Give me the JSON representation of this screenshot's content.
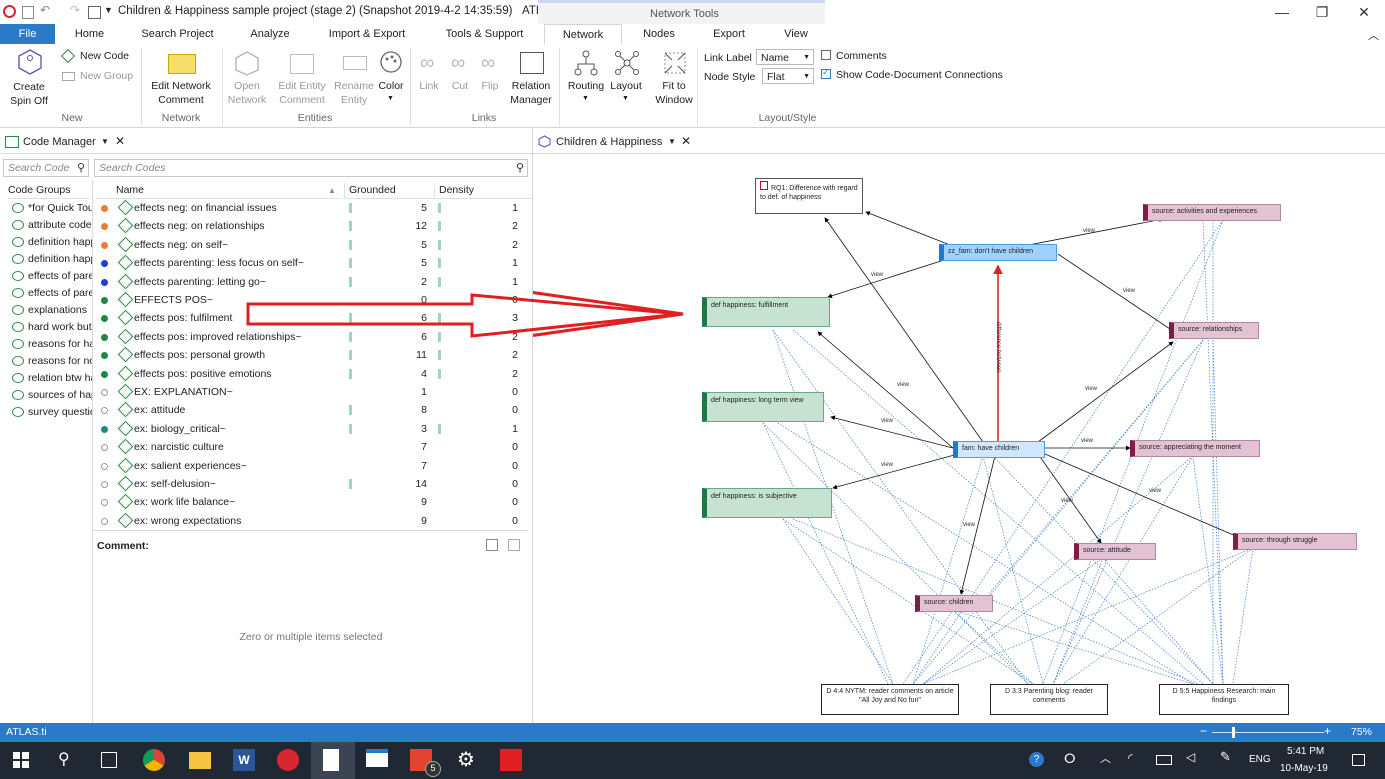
{
  "window": {
    "title": "Children & Happiness sample project (stage 2) (Snapshot 2019-4-2 14:35:59)",
    "app_name": "ATLAS.ti",
    "context_tab_group": "Network Tools",
    "quick_access_checkbox": "▼"
  },
  "ribbon_tabs": [
    "File",
    "Home",
    "Search Project",
    "Analyze",
    "Import & Export",
    "Tools & Support",
    "Network",
    "Nodes",
    "Export",
    "View"
  ],
  "ribbon": {
    "create_spin_off": "Create\nSpin Off",
    "new_code": "New Code",
    "new_group": "New Group",
    "grp_new": "New",
    "edit_network_comment": "Edit Network\nComment",
    "grp_network": "Network",
    "open_network": "Open\nNetwork",
    "edit_entity_comment": "Edit Entity\nComment",
    "rename_entity": "Rename\nEntity",
    "color": "Color",
    "grp_entities": "Entities",
    "link": "Link",
    "cut": "Cut",
    "flip": "Flip",
    "relation_manager": "Relation\nManager",
    "grp_links": "Links",
    "routing": "Routing",
    "layout": "Layout",
    "fit_to_window": "Fit to\nWindow",
    "link_label_lbl": "Link Label",
    "link_label_val": "Name",
    "node_style_lbl": "Node Style",
    "node_style_val": "Flat",
    "comments": "Comments",
    "show_code_doc": "Show Code-Document Connections",
    "grp_layout_style": "Layout/Style"
  },
  "code_manager": {
    "title": "Code Manager",
    "search_code_ph": "Search Code",
    "search_codes_ph": "Search Codes",
    "code_groups_header": "Code Groups",
    "col_name": "Name",
    "col_grounded": "Grounded",
    "col_density": "Density",
    "groups": [
      "*for Quick Tour",
      "attribute codes",
      "definition happiness",
      "definition happiness",
      "effects of parenting",
      "effects of parenting",
      "explanations",
      "hard work but",
      "reasons for having",
      "reasons for not",
      "relation btw happiness",
      "sources of happiness",
      "survey questions"
    ],
    "codes": [
      {
        "name": "effects neg: on financial issues",
        "g": "5",
        "d": "1",
        "dot": "#f07a30",
        "gbar": 1,
        "dbar": 1
      },
      {
        "name": "effects neg: on relationships",
        "g": "12",
        "d": "2",
        "dot": "#f07a30",
        "gbar": 1,
        "dbar": 1
      },
      {
        "name": "effects neg: on self~",
        "g": "5",
        "d": "2",
        "dot": "#f07a30",
        "gbar": 1,
        "dbar": 1
      },
      {
        "name": "effects parenting: less focus on self~",
        "g": "5",
        "d": "1",
        "dot": "#1a3fd6",
        "gbar": 1,
        "dbar": 1
      },
      {
        "name": "effects parenting: letting go~",
        "g": "2",
        "d": "1",
        "dot": "#1a3fd6",
        "gbar": 1,
        "dbar": 1
      },
      {
        "name": "EFFECTS POS~",
        "g": "0",
        "d": "0",
        "dot": "#1c8a3a",
        "gbar": 0,
        "dbar": 0
      },
      {
        "name": "effects pos: fulfilment",
        "g": "6",
        "d": "3",
        "dot": "#1c8a3a",
        "gbar": 1,
        "dbar": 1
      },
      {
        "name": "effects pos: improved relationships~",
        "g": "6",
        "d": "2",
        "dot": "#1c8a3a",
        "gbar": 1,
        "dbar": 1
      },
      {
        "name": "effects pos: personal growth",
        "g": "11",
        "d": "2",
        "dot": "#1c8a3a",
        "gbar": 1,
        "dbar": 1
      },
      {
        "name": "effects pos: positive emotions",
        "g": "4",
        "d": "2",
        "dot": "#1c8a3a",
        "gbar": 1,
        "dbar": 1
      },
      {
        "name": "EX:  EXPLANATION~",
        "g": "1",
        "d": "0",
        "dot": "",
        "gbar": 0,
        "dbar": 0
      },
      {
        "name": "ex: attitude",
        "g": "8",
        "d": "0",
        "dot": "",
        "gbar": 1,
        "dbar": 0
      },
      {
        "name": "ex: biology_critical~",
        "g": "3",
        "d": "1",
        "dot": "#1c8a7a",
        "gbar": 1,
        "dbar": 1
      },
      {
        "name": "ex: narcistic culture",
        "g": "7",
        "d": "0",
        "dot": "",
        "gbar": 0,
        "dbar": 0
      },
      {
        "name": "ex: salient experiences~",
        "g": "7",
        "d": "0",
        "dot": "",
        "gbar": 0,
        "dbar": 0
      },
      {
        "name": "ex: self-delusion~",
        "g": "14",
        "d": "0",
        "dot": "",
        "gbar": 1,
        "dbar": 0
      },
      {
        "name": "ex: work  life balance~",
        "g": "9",
        "d": "0",
        "dot": "",
        "gbar": 0,
        "dbar": 0
      },
      {
        "name": "ex: wrong expectations",
        "g": "9",
        "d": "0",
        "dot": "",
        "gbar": 0,
        "dbar": 0
      }
    ],
    "comment_label": "Comment:",
    "comment_empty": "Zero or multiple items selected"
  },
  "network": {
    "tab_title": "Children & Happiness",
    "nodes": {
      "rq1": "RQ1: Difference with regard to def. of happiness",
      "zz_fam": "zz_fam: don't have children",
      "fam": "fam: have children",
      "def_fulfill": "def happiness: fulfillment",
      "def_long": "def happiness: long term view",
      "def_subj": "def happiness: is subjective",
      "src_act": "source: activities and experiences",
      "src_rel": "source: relationships",
      "src_app": "source: appreciating the moment",
      "src_att": "source: attitude",
      "src_str": "source: through struggle",
      "src_child": "source: children",
      "doc4": "D 4:4  NYTM: reader comments on article \"All Joy and No fun\"",
      "doc3": "D 3:3  Parenting blog: reader comments",
      "doc5": "D 5:5  Happiness Research: main findings"
    },
    "edge_label_view": "view",
    "edge_label_diff": "difference between"
  },
  "statusbar": {
    "app": "ATLAS.ti",
    "zoom": "75%"
  },
  "taskbar": {
    "time": "5:41 PM",
    "date": "10-May-19",
    "lang": "ENG",
    "badge": "5"
  }
}
